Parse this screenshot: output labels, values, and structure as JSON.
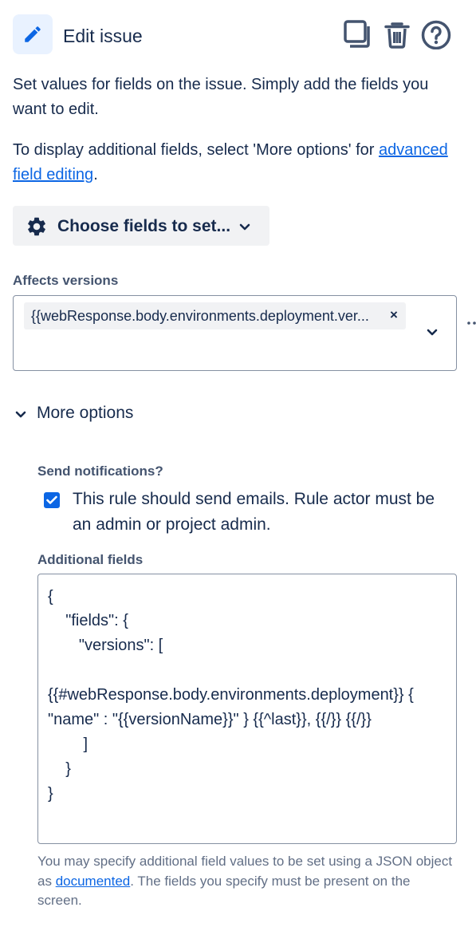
{
  "header": {
    "title": "Edit issue",
    "icon": "pencil-icon",
    "actions": [
      "copy-icon",
      "trash-icon",
      "help-icon"
    ]
  },
  "description": {
    "line1": "Set values for fields on the issue. Simply add the fields you want to edit.",
    "line2_prefix": "To display additional fields, select 'More options' for ",
    "line2_link": "advanced field editing",
    "line2_suffix": "."
  },
  "choose_fields": {
    "label": "Choose fields to set...",
    "icon": "gear-icon"
  },
  "affects_versions": {
    "label": "Affects versions",
    "tag_value": "{{webResponse.body.environments.deployment.ver...",
    "remove_glyph": "×"
  },
  "more_options": {
    "label": "More options",
    "expanded": true
  },
  "send_notifications": {
    "label": "Send notifications?",
    "checked": true,
    "checkbox_label": "This rule should send emails. Rule actor must be an admin or project admin."
  },
  "additional_fields": {
    "label": "Additional fields",
    "lines": [
      "{",
      "    \"fields\": {",
      "       \"versions\": [",
      "",
      "{{#webResponse.body.environments.deployment}} {",
      "\"name\" : \"{{versionName}}\" } {{^last}}, {{/}} {{/}}",
      "        ]",
      "    }",
      "}"
    ]
  },
  "help_text": {
    "prefix": "You may specify additional field values to be set using a JSON object as ",
    "link": "documented",
    "suffix": ". The fields you specify must be present on the screen."
  },
  "colors": {
    "accent": "#0c66e4",
    "text": "#172b4d",
    "subtle": "#44546f",
    "border": "#8590a2",
    "button_bg": "#f1f2f4",
    "icon_bg": "#e9f2ff"
  }
}
